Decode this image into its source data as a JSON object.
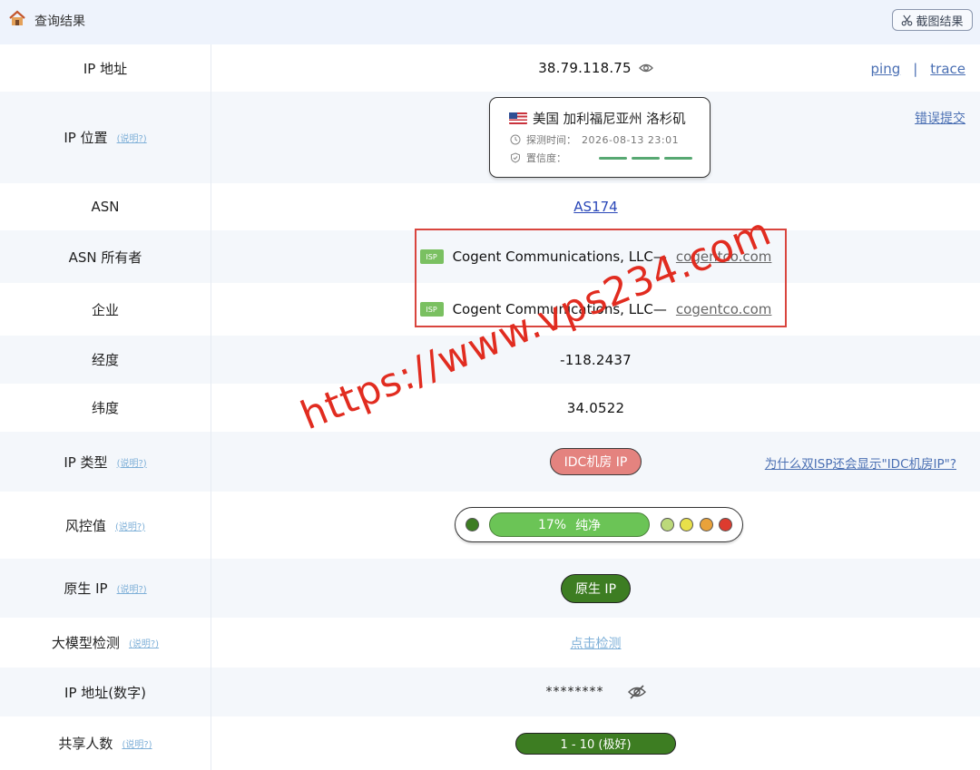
{
  "header": {
    "title": "查询结果",
    "screenshot_label": "截图结果"
  },
  "rows": {
    "ip": {
      "label": "IP 地址",
      "value": "38.79.118.75",
      "ping": "ping",
      "separator": "|",
      "trace": "trace"
    },
    "location": {
      "label": "IP 位置",
      "help": "(说明?)",
      "place": "美国 加利福尼亚州 洛杉矶",
      "detect_label": "探测时间：",
      "detect_time": "2026-08-13 23:01",
      "confidence_label": "置信度：",
      "report": "错误提交"
    },
    "asn": {
      "label": "ASN",
      "value": "AS174"
    },
    "asn_owner": {
      "label": "ASN 所有者",
      "badge": "ISP",
      "name": "Cogent Communications, LLC",
      "dash": "—",
      "domain": "cogentco.com"
    },
    "company": {
      "label": "企业",
      "badge": "ISP",
      "name": "Cogent Communications, LLC",
      "dash": "—",
      "domain": "cogentco.com"
    },
    "longitude": {
      "label": "经度",
      "value": "-118.2437"
    },
    "latitude": {
      "label": "纬度",
      "value": "34.0522"
    },
    "ip_type": {
      "label": "IP 类型",
      "help": "(说明?)",
      "value": "IDC机房 IP",
      "why": "为什么双ISP还会显示\"IDC机房IP\"?"
    },
    "risk": {
      "label": "风控值",
      "help": "(说明?)",
      "percent": "17%",
      "status": "纯净"
    },
    "native": {
      "label": "原生 IP",
      "help": "(说明?)",
      "value": "原生 IP"
    },
    "llm": {
      "label": "大模型检测",
      "help": "(说明?)",
      "value": "点击检测"
    },
    "ip_numeric": {
      "label": "IP 地址(数字)",
      "value": "********"
    },
    "shared": {
      "label": "共享人数",
      "help": "(说明?)",
      "value": "1 - 10 (极好)"
    }
  },
  "watermark": "https://www.vps234.com",
  "colors": {
    "idc_pill": "#e4837f",
    "native_pill": "#3d7d22",
    "risk_bar": "#6bc456",
    "isp_badge": "#7ac061",
    "highlight_box": "#d9453e",
    "link": "#4a6fb3"
  },
  "risk_scale_colors": [
    "#3d7d22",
    "#bcd97a",
    "#e8e04a",
    "#e9a23a",
    "#dd3b2f"
  ]
}
